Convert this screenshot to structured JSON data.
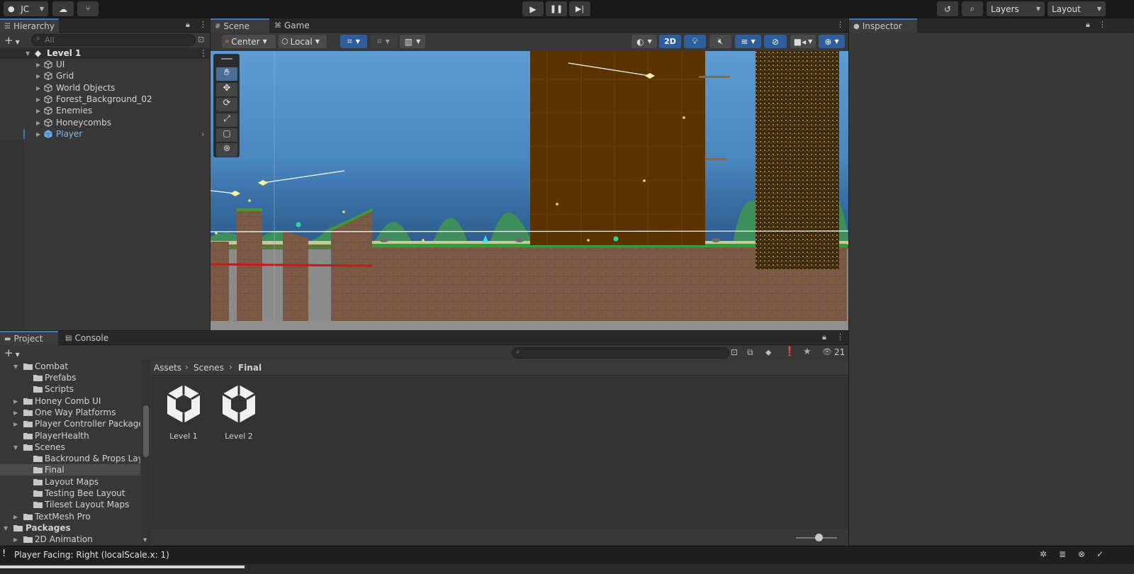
{
  "toolbar": {
    "account": "JC",
    "layers": "Layers",
    "layout": "Layout"
  },
  "hierarchy": {
    "tab": "Hierarchy",
    "search_placeholder": "All",
    "scene_name": "Level 1",
    "items": [
      {
        "label": "UI"
      },
      {
        "label": "Grid"
      },
      {
        "label": "World Objects"
      },
      {
        "label": "Forest_Background_02"
      },
      {
        "label": "Enemies"
      },
      {
        "label": "Honeycombs"
      },
      {
        "label": "Player"
      }
    ]
  },
  "scene": {
    "tabs": [
      {
        "label": "Scene"
      },
      {
        "label": "Game"
      }
    ],
    "pivot": "Center",
    "space": "Local",
    "mode_2d": "2D"
  },
  "inspector": {
    "tab": "Inspector"
  },
  "project": {
    "tabs": [
      {
        "label": "Project"
      },
      {
        "label": "Console"
      }
    ],
    "visible_count": "21",
    "breadcrumb": [
      "Assets",
      "Scenes",
      "Final"
    ],
    "tree": [
      {
        "label": "Combat",
        "level": 1,
        "expanded": true
      },
      {
        "label": "Prefabs",
        "level": 2
      },
      {
        "label": "Scripts",
        "level": 2
      },
      {
        "label": "Honey Comb UI",
        "level": 1,
        "collapsed": true
      },
      {
        "label": "One Way Platforms",
        "level": 1,
        "collapsed": true
      },
      {
        "label": "Player Controller Package",
        "level": 1,
        "collapsed": true
      },
      {
        "label": "PlayerHealth",
        "level": 1
      },
      {
        "label": "Scenes",
        "level": 1,
        "expanded": true
      },
      {
        "label": "Backround & Props Layout",
        "level": 2
      },
      {
        "label": "Final",
        "level": 2,
        "selected": true
      },
      {
        "label": "Layout Maps",
        "level": 2
      },
      {
        "label": "Testing Bee Layout",
        "level": 2
      },
      {
        "label": "Tileset Layout Maps",
        "level": 2
      },
      {
        "label": "TextMesh Pro",
        "level": 1,
        "collapsed": true
      },
      {
        "label": "Packages",
        "level": 0,
        "expanded": true,
        "bold": true
      },
      {
        "label": "2D Animation",
        "level": 1,
        "collapsed": true
      }
    ],
    "assets": [
      {
        "label": "Level 1"
      },
      {
        "label": "Level 2"
      }
    ]
  },
  "status": {
    "message": "Player Facing: Right (localScale.x: 1)"
  },
  "colors": {
    "accent": "#3a79bb",
    "selected_text": "#7fb6f0",
    "sky": "#5a9bd0",
    "dirt": "#7b5a46",
    "wall": "#5a3300"
  }
}
